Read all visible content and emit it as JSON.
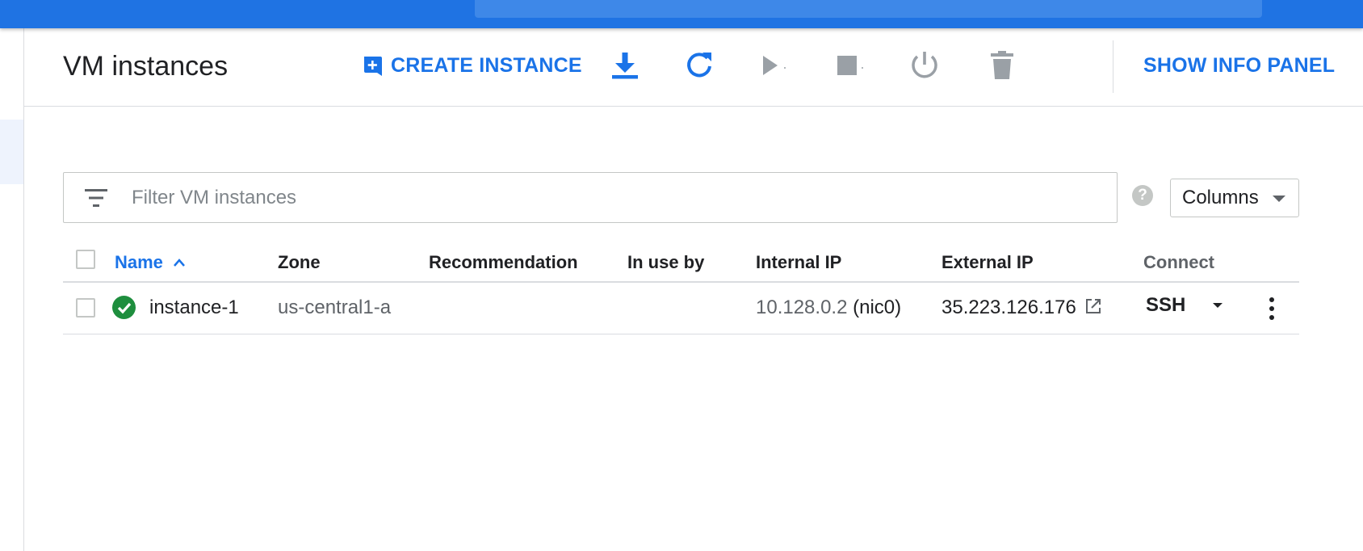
{
  "page": {
    "title": "VM instances"
  },
  "toolbar": {
    "create_label": "CREATE INSTANCE",
    "show_info_label": "SHOW INFO PANEL",
    "icons": [
      "import-icon",
      "refresh-icon",
      "start-icon",
      "stop-icon",
      "reset-icon",
      "delete-icon"
    ]
  },
  "filter": {
    "placeholder": "Filter VM instances",
    "value": ""
  },
  "columns_button": {
    "label": "Columns"
  },
  "help": {
    "glyph": "?"
  },
  "table": {
    "headers": {
      "name": "Name",
      "zone": "Zone",
      "recommendation": "Recommendation",
      "in_use_by": "In use by",
      "internal_ip": "Internal IP",
      "external_ip": "External IP",
      "connect": "Connect"
    },
    "sort": {
      "column": "Name",
      "direction": "ascending"
    },
    "rows": [
      {
        "status": "running",
        "name": "instance-1",
        "zone": "us-central1-a",
        "recommendation": "",
        "in_use_by": "",
        "internal_ip": "10.128.0.2",
        "internal_nic": "(nic0)",
        "external_ip": "35.223.126.176",
        "connect": "SSH"
      }
    ]
  },
  "colors": {
    "topbar": "#1f73e3",
    "accent": "#1a73e8",
    "status_ok": "#1e8e3e",
    "disabled_icon": "#9aa0a6"
  }
}
